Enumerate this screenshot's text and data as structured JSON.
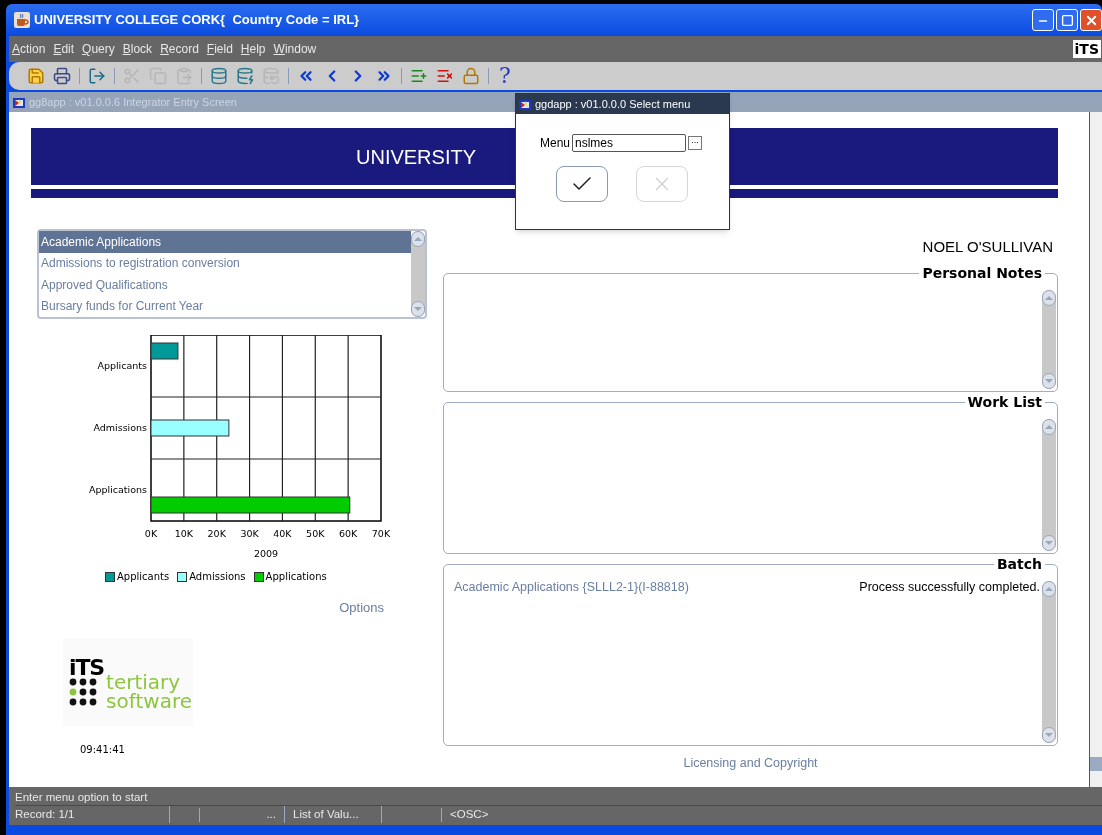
{
  "window": {
    "title": "UNIVERSITY COLLEGE CORK{  Country Code = IRL}"
  },
  "menu_bar": {
    "items": [
      "Action",
      "Edit",
      "Query",
      "Block",
      "Record",
      "Field",
      "Help",
      "Window"
    ],
    "logo": "iTS"
  },
  "toolbar": {
    "groups": [
      [
        {
          "kind": "save",
          "disabled": false
        },
        {
          "kind": "print",
          "disabled": false
        }
      ],
      [
        {
          "kind": "exit",
          "disabled": false
        }
      ],
      [
        {
          "kind": "cut",
          "disabled": true
        },
        {
          "kind": "copy",
          "disabled": true
        },
        {
          "kind": "paste",
          "disabled": true
        }
      ],
      [
        {
          "kind": "enter-query",
          "disabled": false
        },
        {
          "kind": "execute-query",
          "disabled": false
        },
        {
          "kind": "cancel-query",
          "disabled": true
        }
      ],
      [
        {
          "kind": "first",
          "disabled": false
        },
        {
          "kind": "previous",
          "disabled": false
        },
        {
          "kind": "next",
          "disabled": false
        },
        {
          "kind": "last",
          "disabled": false
        }
      ],
      [
        {
          "kind": "insert",
          "disabled": false
        },
        {
          "kind": "delete",
          "disabled": false
        },
        {
          "kind": "lock",
          "disabled": false
        }
      ],
      [
        {
          "kind": "help",
          "disabled": false,
          "label": "?"
        }
      ]
    ]
  },
  "inner_window": {
    "title": "gg8app : v01.0.0.6 Integrator Entry Screen",
    "banner": "UNIVERSITY"
  },
  "dialog": {
    "title": "ggdapp : v01.0.0.0 Select menu",
    "field_label": "Menu",
    "field_value": "nslmes",
    "lov_button": "...",
    "ok_disabled": false,
    "cancel_disabled": true
  },
  "report_list": {
    "items": [
      {
        "label": "Academic Applications",
        "selected": true
      },
      {
        "label": "Admissions to registration conversion",
        "selected": false
      },
      {
        "label": "Approved Qualifications",
        "selected": false
      },
      {
        "label": "Bursary funds for Current Year",
        "selected": false
      }
    ]
  },
  "chart": {
    "chart_data": {
      "type": "bar",
      "orientation": "horizontal",
      "grid": true,
      "legend": true,
      "xlabel": "2009",
      "categories": [
        "Applicants",
        "Admissions",
        "Applications"
      ],
      "series": [
        {
          "name": "Applicants",
          "color": "#009999",
          "values": [
            8200,
            null,
            null
          ]
        },
        {
          "name": "Admissions",
          "color": "#99ffff",
          "values": [
            null,
            23700,
            null
          ]
        },
        {
          "name": "Applications",
          "color": "#00cc00",
          "values": [
            null,
            null,
            60500
          ]
        }
      ],
      "xlim": [
        0,
        70000
      ],
      "xticks": [
        {
          "value": 0,
          "label": "0K"
        },
        {
          "value": 10000,
          "label": "10K"
        },
        {
          "value": 20000,
          "label": "20K"
        },
        {
          "value": 30000,
          "label": "30K"
        },
        {
          "value": 40000,
          "label": "40K"
        },
        {
          "value": 50000,
          "label": "50K"
        },
        {
          "value": 60000,
          "label": "60K"
        },
        {
          "value": 70000,
          "label": "70K"
        }
      ]
    }
  },
  "options_link": "Options",
  "logo": {
    "mark": "iTS",
    "line1": "tertiary",
    "line2": "software"
  },
  "clock": "09:41:41",
  "user_name": "NOEL O'SULLIVAN",
  "panels": [
    {
      "title": "Personal Notes"
    },
    {
      "title": "Work List"
    },
    {
      "title": "Batch",
      "rows": [
        {
          "job": "Academic Applications {SLLL2-1}(I-88818)",
          "status": "Process successfully completed."
        }
      ]
    }
  ],
  "licensing_link": "Licensing and Copyright",
  "status_bar": {
    "message": "Enter menu option to start",
    "cells": [
      "Record: 1/1",
      "...",
      "List of Valu...",
      "<OSC>"
    ]
  }
}
